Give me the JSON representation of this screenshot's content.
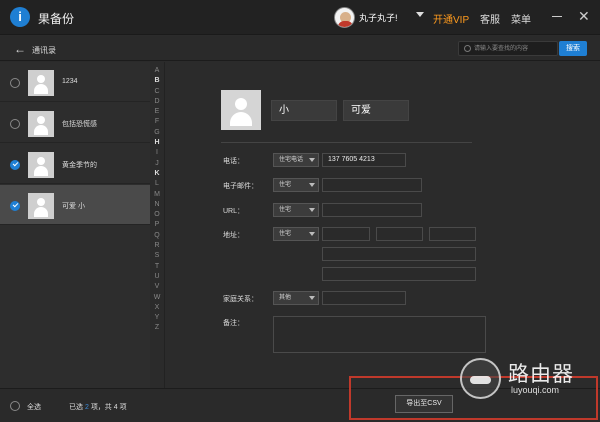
{
  "app": {
    "title": "果备份"
  },
  "user": {
    "name": "丸子丸子!"
  },
  "titlebar": {
    "vip_label": "开通VIP",
    "service_label": "客服",
    "menu_label": "菜单",
    "close_symbol": "✕"
  },
  "subheader": {
    "back_symbol": "←",
    "title": "通讯录",
    "search_placeholder": "请输入要查找的内容",
    "search_button": "搜索"
  },
  "contacts": [
    {
      "name": "1234",
      "checked": false
    },
    {
      "name": "包括恐慌感",
      "checked": false
    },
    {
      "name": "黄金季节的",
      "checked": true
    },
    {
      "name": "可爱 小",
      "checked": true
    }
  ],
  "alphabet": [
    "A",
    "B",
    "C",
    "D",
    "E",
    "F",
    "G",
    "H",
    "I",
    "J",
    "K",
    "L",
    "M",
    "N",
    "O",
    "P",
    "Q",
    "R",
    "S",
    "T",
    "U",
    "V",
    "W",
    "X",
    "Y",
    "Z"
  ],
  "detail": {
    "first_name": "小",
    "last_name": "可爱",
    "phone": {
      "label": "电话：",
      "type": "住宅电话",
      "value": "137 7605 4213"
    },
    "email": {
      "label": "电子邮件：",
      "type": "住宅",
      "value": ""
    },
    "url": {
      "label": "URL：",
      "type": "住宅",
      "value": ""
    },
    "address": {
      "label": "地址：",
      "type": "住宅"
    },
    "family": {
      "label": "家庭关系：",
      "type": "其他",
      "value": ""
    },
    "notes": {
      "label": "备注：",
      "value": ""
    }
  },
  "footer": {
    "select_all": "全选",
    "summary_prefix": "已选",
    "selected_count": "2",
    "summary_suffix": "项，共 4 项",
    "export_button": "导出至CSV"
  },
  "watermark": {
    "text": "路由器",
    "url": "luyouqi.com"
  },
  "colors": {
    "accent": "#1f7fd3",
    "vip": "#ff9b1e",
    "highlight": "#c0392b"
  }
}
